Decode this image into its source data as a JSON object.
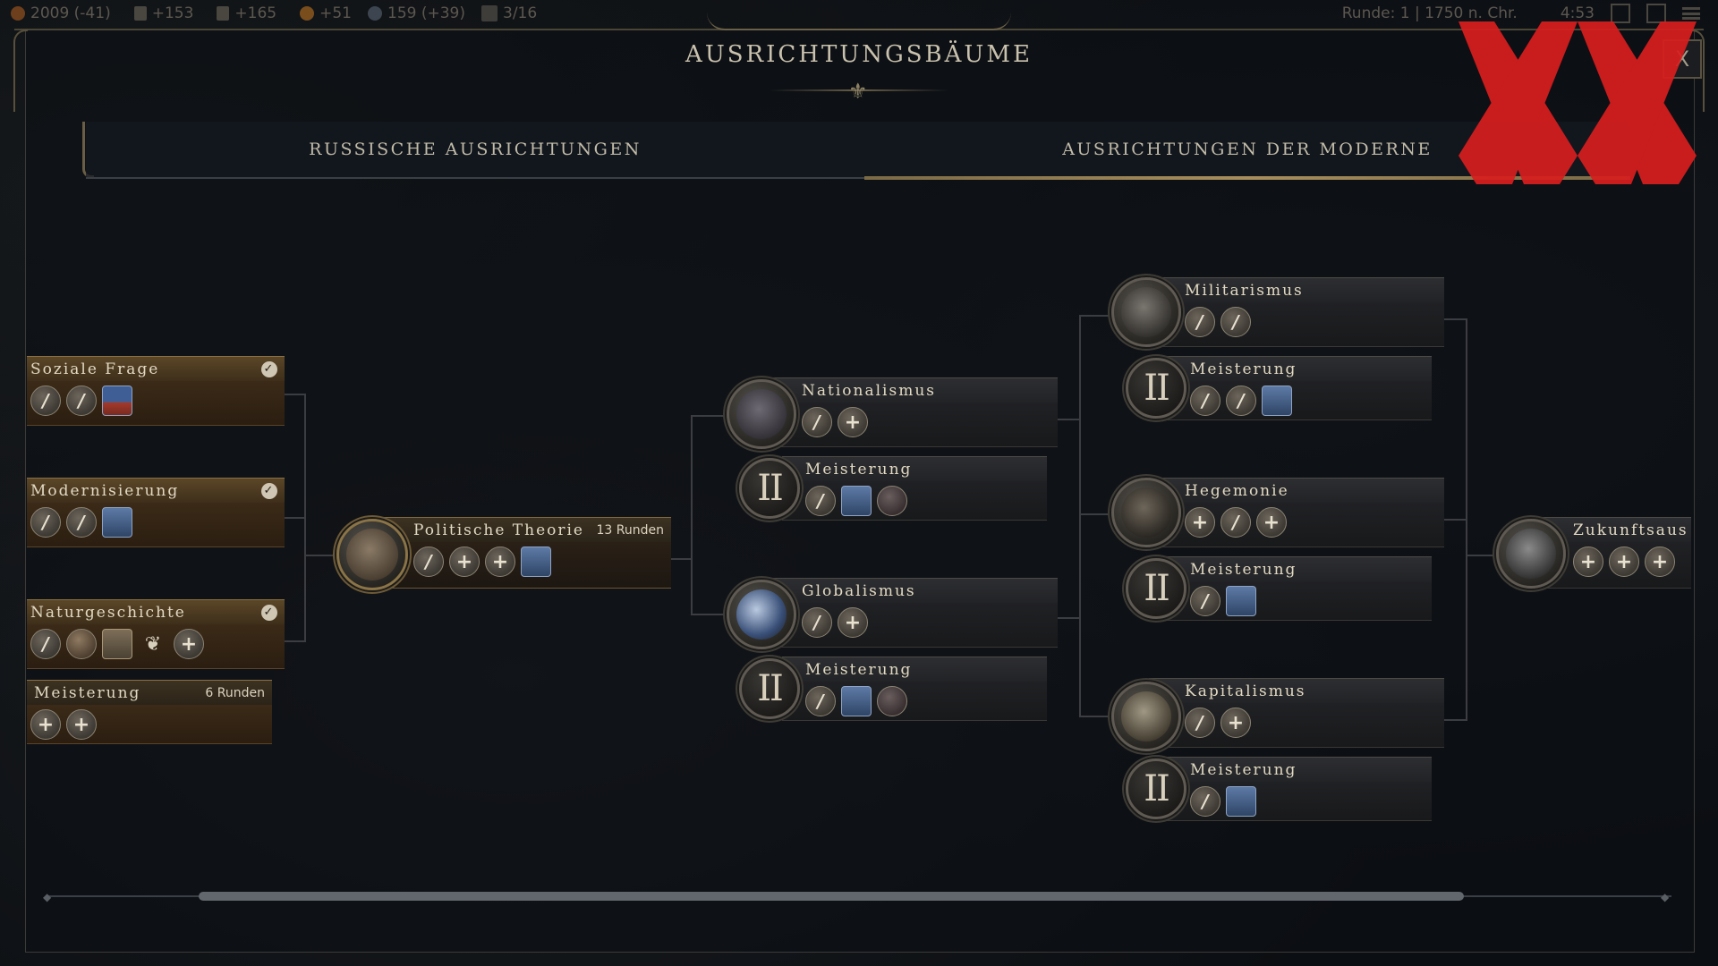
{
  "topbar": {
    "resources": [
      {
        "icon": "gold-icon",
        "value": "2009 (-41)",
        "color": "#7a4a22"
      },
      {
        "icon": "flask-icon",
        "value": "+153",
        "color": "#55504a"
      },
      {
        "icon": "music-icon",
        "value": "+165",
        "color": "#55504a"
      },
      {
        "icon": "coin-icon",
        "value": "+51",
        "color": "#8a5a20"
      },
      {
        "icon": "globe-icon",
        "value": "159 (+39)",
        "color": "#45505a"
      },
      {
        "icon": "city-icon",
        "value": "3/16",
        "color": "#4a4845"
      }
    ],
    "turn": "Runde: 1 | 1750 n. Chr.",
    "clock": "4:53"
  },
  "title": "AUSRICHTUNGSBÄUME",
  "tabs": [
    {
      "label": "RUSSISCHE AUSRICHTUNGEN",
      "active": false
    },
    {
      "label": "AUSRICHTUNGEN DER MODERNE",
      "active": true
    }
  ],
  "close_label": "X",
  "tree": {
    "soziale_frage": {
      "name": "Soziale Frage",
      "done": "✓"
    },
    "modernisierung": {
      "name": "Modernisierung",
      "done": "✓"
    },
    "naturgeschichte": {
      "name": "Naturgeschichte",
      "done": "✓"
    },
    "natur_meisterung": {
      "name": "Meisterung",
      "turns": "6 Runden"
    },
    "politische_theorie": {
      "name": "Politische Theorie",
      "turns": "13 Runden"
    },
    "nationalismus": {
      "name": "Nationalismus"
    },
    "nationalismus_meisterung": {
      "name": "Meisterung",
      "level": "II"
    },
    "globalismus": {
      "name": "Globalismus"
    },
    "globalismus_meisterung": {
      "name": "Meisterung",
      "level": "II"
    },
    "militarismus": {
      "name": "Militarismus"
    },
    "militarismus_meisterung": {
      "name": "Meisterung",
      "level": "II"
    },
    "hegemonie": {
      "name": "Hegemonie"
    },
    "hegemonie_meisterung": {
      "name": "Meisterung",
      "level": "II"
    },
    "kapitalismus": {
      "name": "Kapitalismus"
    },
    "kapitalismus_meisterung": {
      "name": "Meisterung",
      "level": "II"
    },
    "zukunft": {
      "name": "Zukunftsaus"
    }
  },
  "icon_glyphs": {
    "plus": "+"
  },
  "colors": {
    "gold_accent": "#a78e5c",
    "watermark_red": "#d81e1e"
  }
}
